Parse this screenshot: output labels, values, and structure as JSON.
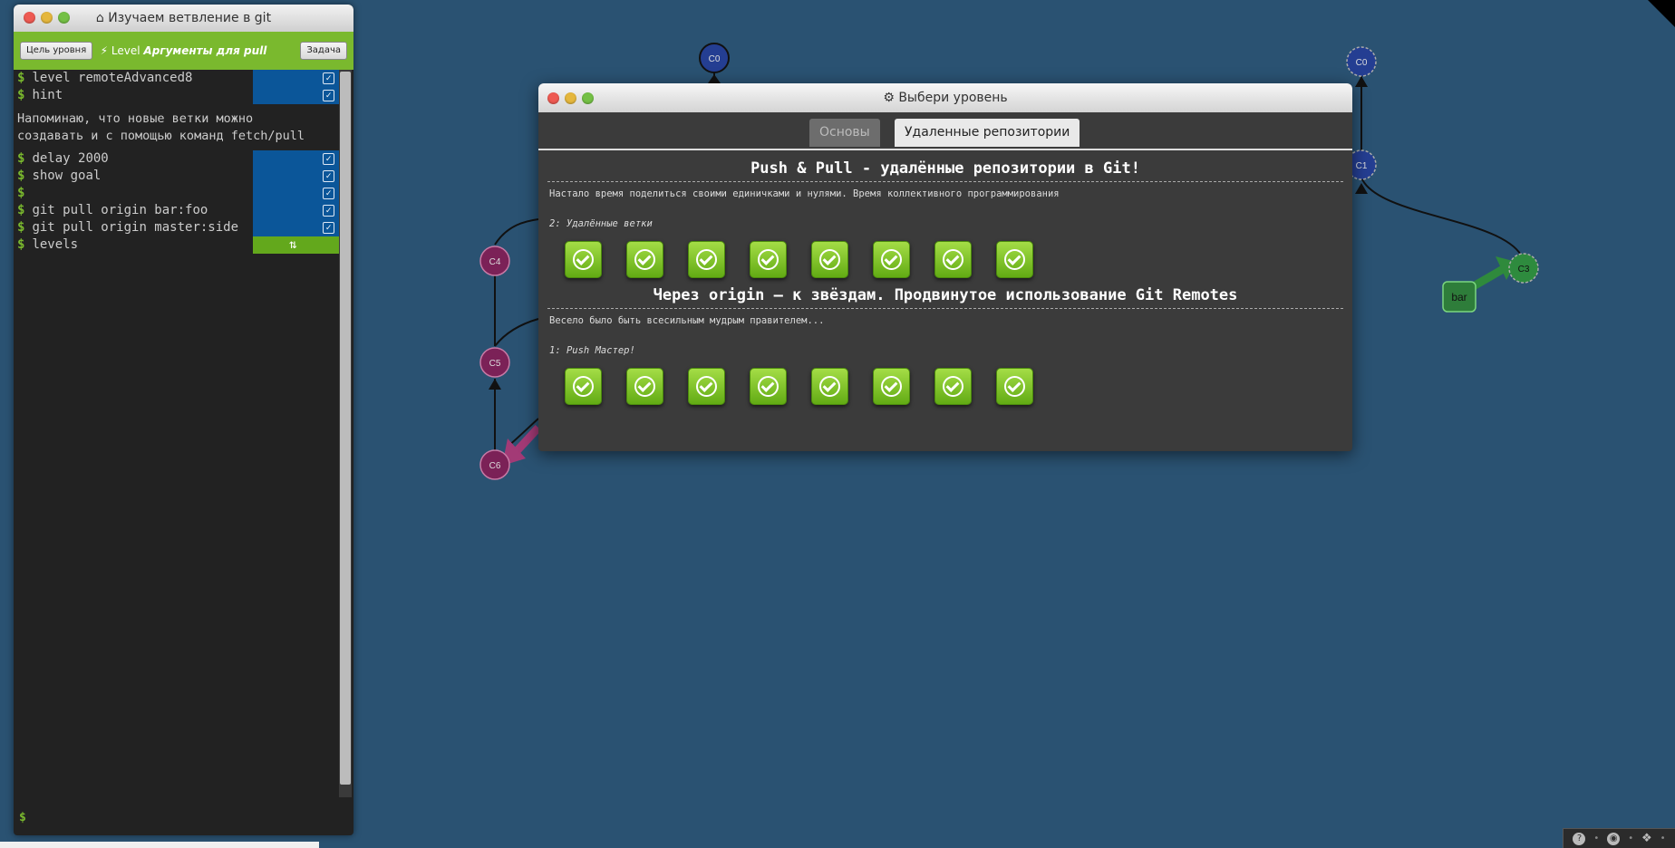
{
  "app": {
    "terminal_title": "Изучаем ветвление в git",
    "home_icon": "home-icon"
  },
  "levelbar": {
    "goal_button": "Цель уровня",
    "task_button": "Задача",
    "level_prefix": "Level",
    "level_name": "Аргументы для pull"
  },
  "terminal": {
    "commands_top": [
      {
        "text": "level remoteAdvanced8",
        "state": "done"
      },
      {
        "text": "hint",
        "state": "done"
      }
    ],
    "note_line1": "Напоминаю, что новые ветки можно",
    "note_line2": "создавать и с помощью команд fetch/pull",
    "commands_bottom": [
      {
        "text": "delay 2000",
        "state": "done"
      },
      {
        "text": "show goal",
        "state": "done"
      },
      {
        "text": "",
        "state": "done"
      },
      {
        "text": "git pull origin bar:foo",
        "state": "done"
      },
      {
        "text": "git pull origin master:side",
        "state": "done"
      },
      {
        "text": "levels",
        "state": "now"
      }
    ],
    "prompt": "$"
  },
  "graph": {
    "commits": [
      {
        "label": "C0",
        "color": "#243e92"
      },
      {
        "label": "C0",
        "color": "#243e92"
      },
      {
        "label": "C1",
        "color": "#243e92"
      },
      {
        "label": "C3",
        "color": "#2e8b3e"
      },
      {
        "label": "C4",
        "color": "#7b2157"
      },
      {
        "label": "C5",
        "color": "#7b2157"
      },
      {
        "label": "C6",
        "color": "#7b2157"
      }
    ],
    "branch_bar": "bar"
  },
  "modal": {
    "title": "Выбери уровень",
    "gear_icon": "gear-icon",
    "tabs": [
      "Основы",
      "Удаленные репозитории"
    ],
    "sections": [
      {
        "title": "Push & Pull - удалённые репозитории в Git!",
        "description": "Настало время поделиться своими единичками и нулями. Время коллективного программирования",
        "subtitle": "2: Удалённые ветки",
        "level_count": 8
      },
      {
        "title": "Через origin – к звёздам. Продвинутое использование Git Remotes",
        "description": "Весело было быть всесильным мудрым правителем...",
        "subtitle": "1: Push Мастер!",
        "level_count": 8
      }
    ]
  },
  "footer": {
    "icons": [
      "help-icon",
      "globe-icon",
      "twitter-icon"
    ]
  },
  "colors": {
    "background": "#2a5272",
    "accent_green": "#7ab92e",
    "command_done": "#0b5699"
  }
}
